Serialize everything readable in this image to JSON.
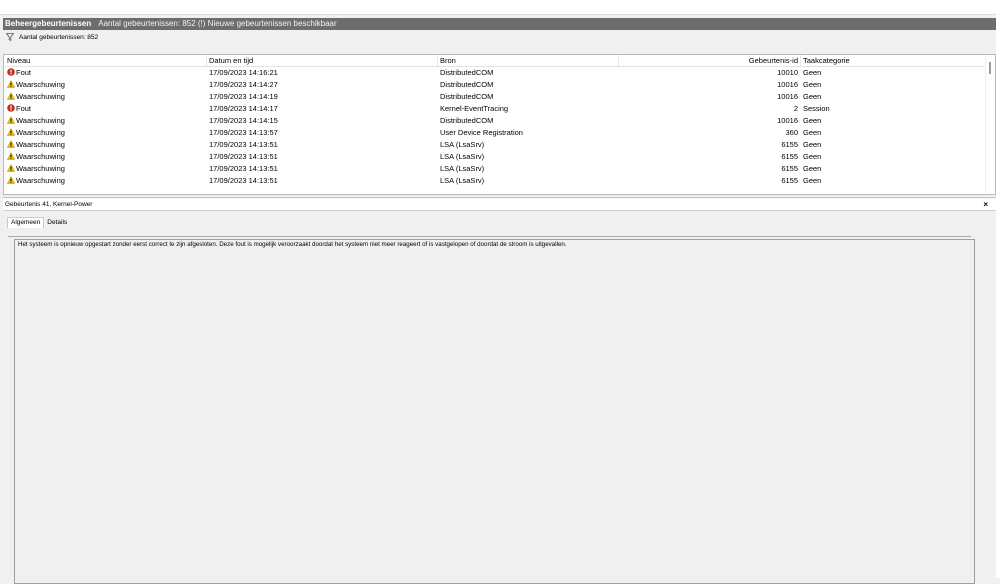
{
  "titlebar": {
    "title": "Beheergebeurtenissen",
    "subtitle": "Aantal gebeurtenissen: 852 (!) Nieuwe gebeurtenissen beschikbaar"
  },
  "filter": {
    "icon": "filter-icon",
    "text": "Aantal gebeurtenissen: 852"
  },
  "table": {
    "columns": [
      "Niveau",
      "Datum en tijd",
      "Bron",
      "Gebeurtenis-id",
      "Taakcategorie"
    ],
    "rows": [
      {
        "level": "Fout",
        "icon": "error-icon",
        "datetime": "17/09/2023 14:16:21",
        "source": "DistributedCOM",
        "id": "10010",
        "category": "Geen"
      },
      {
        "level": "Waarschuwing",
        "icon": "warning-icon",
        "datetime": "17/09/2023 14:14:27",
        "source": "DistributedCOM",
        "id": "10016",
        "category": "Geen"
      },
      {
        "level": "Waarschuwing",
        "icon": "warning-icon",
        "datetime": "17/09/2023 14:14:19",
        "source": "DistributedCOM",
        "id": "10016",
        "category": "Geen"
      },
      {
        "level": "Fout",
        "icon": "error-icon",
        "datetime": "17/09/2023 14:14:17",
        "source": "Kernel-EventTracing",
        "id": "2",
        "category": "Session"
      },
      {
        "level": "Waarschuwing",
        "icon": "warning-icon",
        "datetime": "17/09/2023 14:14:15",
        "source": "DistributedCOM",
        "id": "10016",
        "category": "Geen"
      },
      {
        "level": "Waarschuwing",
        "icon": "warning-icon",
        "datetime": "17/09/2023 14:13:57",
        "source": "User Device Registration",
        "id": "360",
        "category": "Geen"
      },
      {
        "level": "Waarschuwing",
        "icon": "warning-icon",
        "datetime": "17/09/2023 14:13:51",
        "source": "LSA (LsaSrv)",
        "id": "6155",
        "category": "Geen"
      },
      {
        "level": "Waarschuwing",
        "icon": "warning-icon",
        "datetime": "17/09/2023 14:13:51",
        "source": "LSA (LsaSrv)",
        "id": "6155",
        "category": "Geen"
      },
      {
        "level": "Waarschuwing",
        "icon": "warning-icon",
        "datetime": "17/09/2023 14:13:51",
        "source": "LSA (LsaSrv)",
        "id": "6155",
        "category": "Geen"
      },
      {
        "level": "Waarschuwing",
        "icon": "warning-icon",
        "datetime": "17/09/2023 14:13:51",
        "source": "LSA (LsaSrv)",
        "id": "6155",
        "category": "Geen"
      }
    ]
  },
  "detail": {
    "header": "Gebeurtenis 41, Kernel-Power",
    "close_label": "×",
    "tabs": [
      "Algemeen",
      "Details"
    ],
    "active_tab": "Algemeen",
    "description": "Het systeem is opnieuw opgestart zonder eerst correct te zijn afgesloten. Deze fout is mogelijk veroorzaakt doordat het systeem niet meer reageert of is vastgelopen of doordat de stroom is uitgevallen."
  },
  "colors": {
    "titlebar_bg": "#6d6d6d",
    "error_red": "#c42b1c",
    "warning_yellow": "#f2c200"
  }
}
